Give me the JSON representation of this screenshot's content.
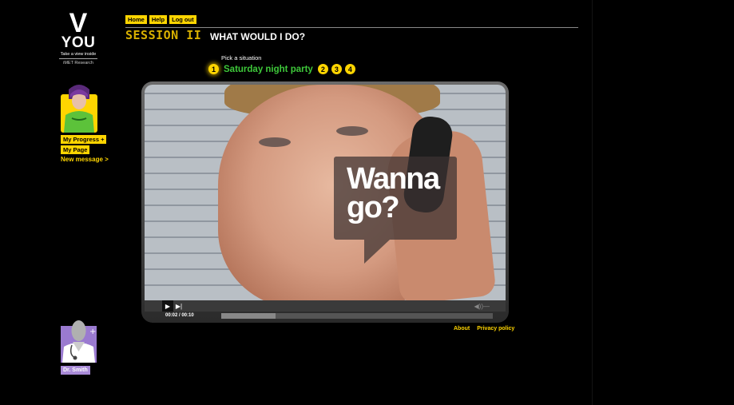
{
  "logo": {
    "mark": "V",
    "word": "YOU",
    "tagline": "Take a view inside",
    "org": "iMET Research"
  },
  "sidebar": {
    "my_progress": "My Progress +",
    "my_page": "My Page",
    "new_message": "New message >",
    "doctor_name": "Dr. Smith"
  },
  "nav": {
    "home": "Home",
    "help": "Help",
    "logout": "Log out"
  },
  "header": {
    "session": "SESSION II",
    "title": "WHAT WOULD I DO?"
  },
  "situations": {
    "prompt": "Pick a situation",
    "active_number": "1",
    "active_label": "Saturday night party",
    "others": [
      "2",
      "3",
      "4"
    ]
  },
  "video": {
    "caption": "Wanna go?",
    "time": "00:02 / 00:10",
    "progress": 0.2
  },
  "footer": {
    "about": "About",
    "privacy": "Privacy policy"
  },
  "colors": {
    "accent": "#ffd500",
    "situation_green": "#3ec83a",
    "doctor_badge": "#a98bd8"
  }
}
